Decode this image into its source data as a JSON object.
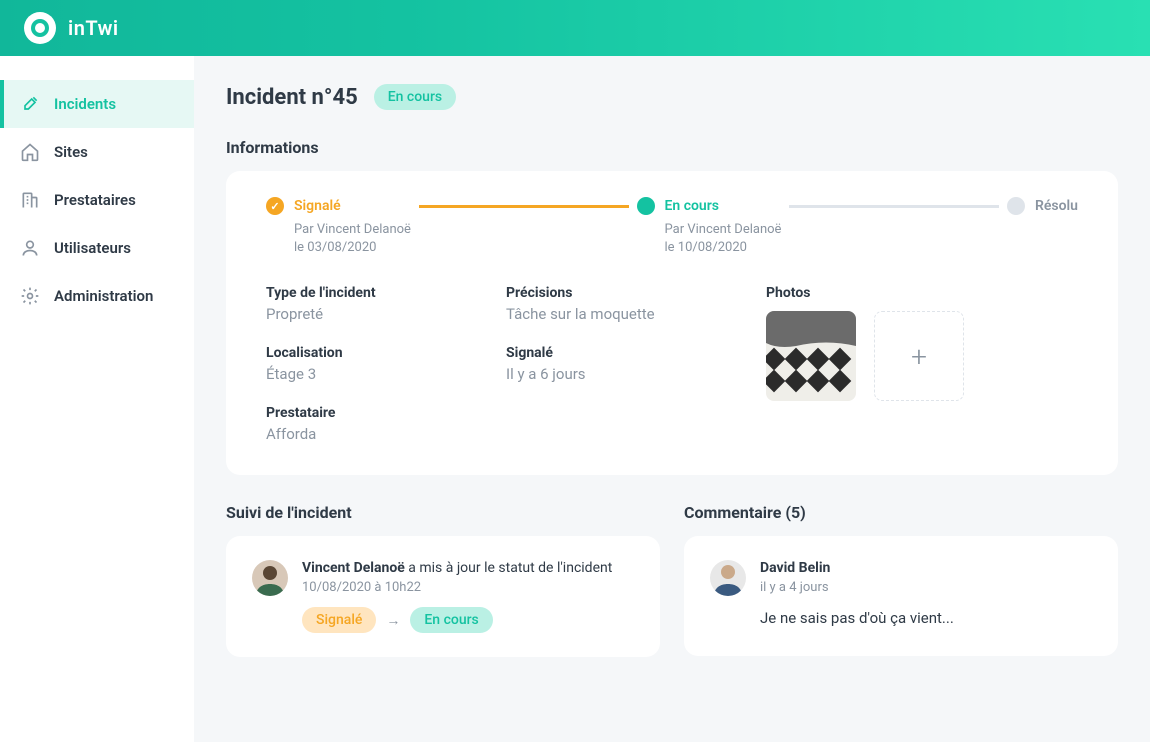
{
  "brand": {
    "name": "inTwi"
  },
  "sidebar": {
    "items": [
      {
        "id": "incidents",
        "label": "Incidents",
        "icon": "wrench-icon",
        "active": true
      },
      {
        "id": "sites",
        "label": "Sites",
        "icon": "home-icon",
        "active": false
      },
      {
        "id": "prestataires",
        "label": "Prestataires",
        "icon": "building-icon",
        "active": false
      },
      {
        "id": "utilisateurs",
        "label": "Utilisateurs",
        "icon": "user-icon",
        "active": false
      },
      {
        "id": "administration",
        "label": "Administration",
        "icon": "gear-icon",
        "active": false
      }
    ]
  },
  "header": {
    "title": "Incident n°45",
    "status": "En cours"
  },
  "sections": {
    "info": "Informations",
    "feed": "Suivi de l'incident",
    "comments": "Commentaire (5)"
  },
  "progress": {
    "steps": [
      {
        "state": "done",
        "label": "Signalé",
        "by": "Par Vincent Delanoë",
        "date": "le 03/08/2020"
      },
      {
        "state": "current",
        "label": "En cours",
        "by": "Par Vincent Delanoë",
        "date": "le 10/08/2020"
      },
      {
        "state": "future",
        "label": "Résolu"
      }
    ]
  },
  "info": {
    "type_label": "Type de l'incident",
    "type_value": "Propreté",
    "localisation_label": "Localisation",
    "localisation_value": "Étage 3",
    "prestataire_label": "Prestataire",
    "prestataire_value": "Afforda",
    "precisions_label": "Précisions",
    "precisions_value": "Tâche sur la moquette",
    "signale_label": "Signalé",
    "signale_value": "Il y a 6 jours",
    "photos_label": "Photos"
  },
  "feed": {
    "author": "Vincent Delanoë",
    "action_suffix": " a mis à jour le statut de l'incident",
    "timestamp": "10/08/2020 à 10h22",
    "from_status": "Signalé",
    "to_status": "En cours"
  },
  "comment": {
    "author": "David Belin",
    "timestamp": "il y a 4 jours",
    "text": "Je ne sais pas d'où ça vient..."
  },
  "colors": {
    "teal": "#14c2a1",
    "orange": "#f5a623"
  }
}
